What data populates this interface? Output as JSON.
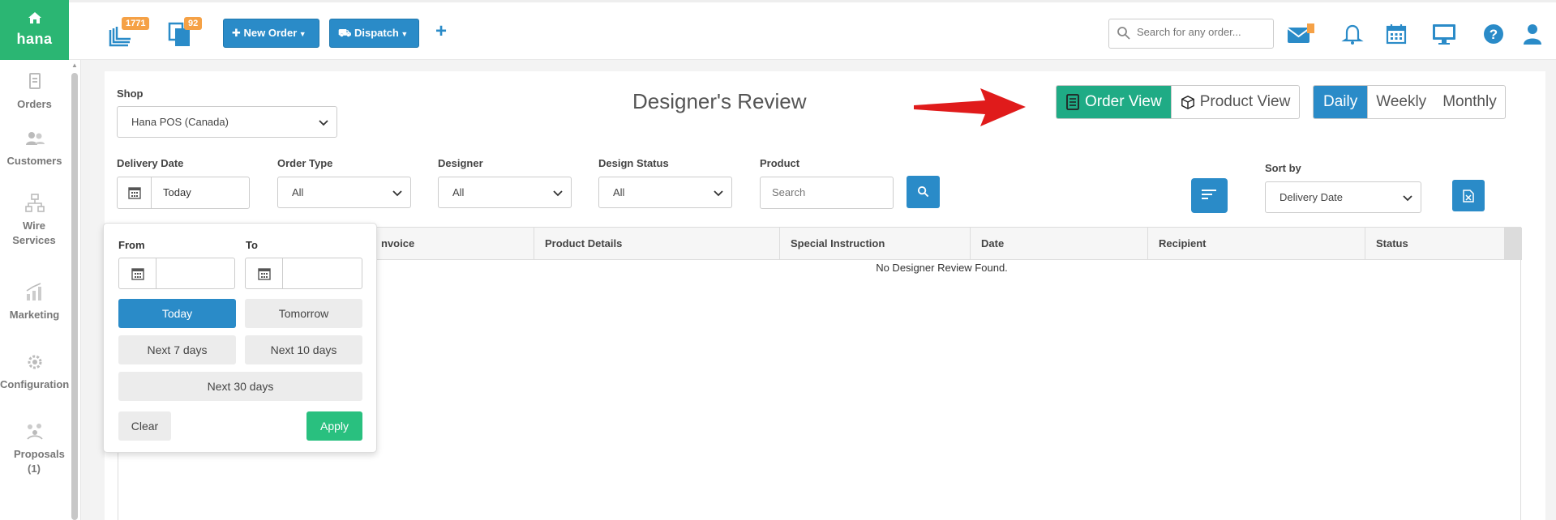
{
  "brand": {
    "name": "hana",
    "icon": "home-icon"
  },
  "sidebar": {
    "items": [
      {
        "label": "Orders",
        "icon": "orders-icon"
      },
      {
        "label": "Customers",
        "icon": "customers-icon"
      },
      {
        "label": "Wire Services",
        "icon": "wire-services-icon"
      },
      {
        "label": "Marketing",
        "icon": "marketing-icon"
      },
      {
        "label": "Configuration",
        "icon": "configuration-icon"
      },
      {
        "label": "Proposals (1)",
        "icon": "proposals-icon"
      }
    ]
  },
  "topbar": {
    "orders_badge": "1771",
    "copies_badge": "92",
    "new_order_label": "New Order",
    "dispatch_label": "Dispatch",
    "add_label": "+",
    "search_placeholder": "Search for any order...",
    "colors": {
      "blue": "#2a8bc8",
      "badge": "#f5a146"
    }
  },
  "filters": {
    "shop_label": "Shop",
    "shop_value": "Hana POS (Canada)",
    "delivery_date_label": "Delivery Date",
    "delivery_date_value": "Today",
    "order_type_label": "Order Type",
    "order_type_value": "All",
    "designer_label": "Designer",
    "designer_value": "All",
    "design_status_label": "Design Status",
    "design_status_value": "All",
    "product_label": "Product",
    "product_placeholder": "Search",
    "sort_by_label": "Sort by",
    "sort_by_value": "Delivery Date"
  },
  "page": {
    "title": "Designer's Review"
  },
  "view_toggle": {
    "order_view": "Order View",
    "product_view": "Product View",
    "active": "Order View",
    "color": "#1fab85"
  },
  "period_toggle": {
    "daily": "Daily",
    "weekly": "Weekly",
    "monthly": "Monthly",
    "active": "Daily"
  },
  "table": {
    "columns": [
      "Invoice",
      "Product Details",
      "Special Instruction",
      "Date",
      "Recipient",
      "Status"
    ],
    "visible_first_column": "nvoice",
    "empty_message": "No Designer Review Found."
  },
  "date_popup": {
    "from_label": "From",
    "to_label": "To",
    "today": "Today",
    "tomorrow": "Tomorrow",
    "next7": "Next 7 days",
    "next10": "Next 10 days",
    "next30": "Next 30 days",
    "clear": "Clear",
    "apply": "Apply",
    "active": "Today"
  }
}
